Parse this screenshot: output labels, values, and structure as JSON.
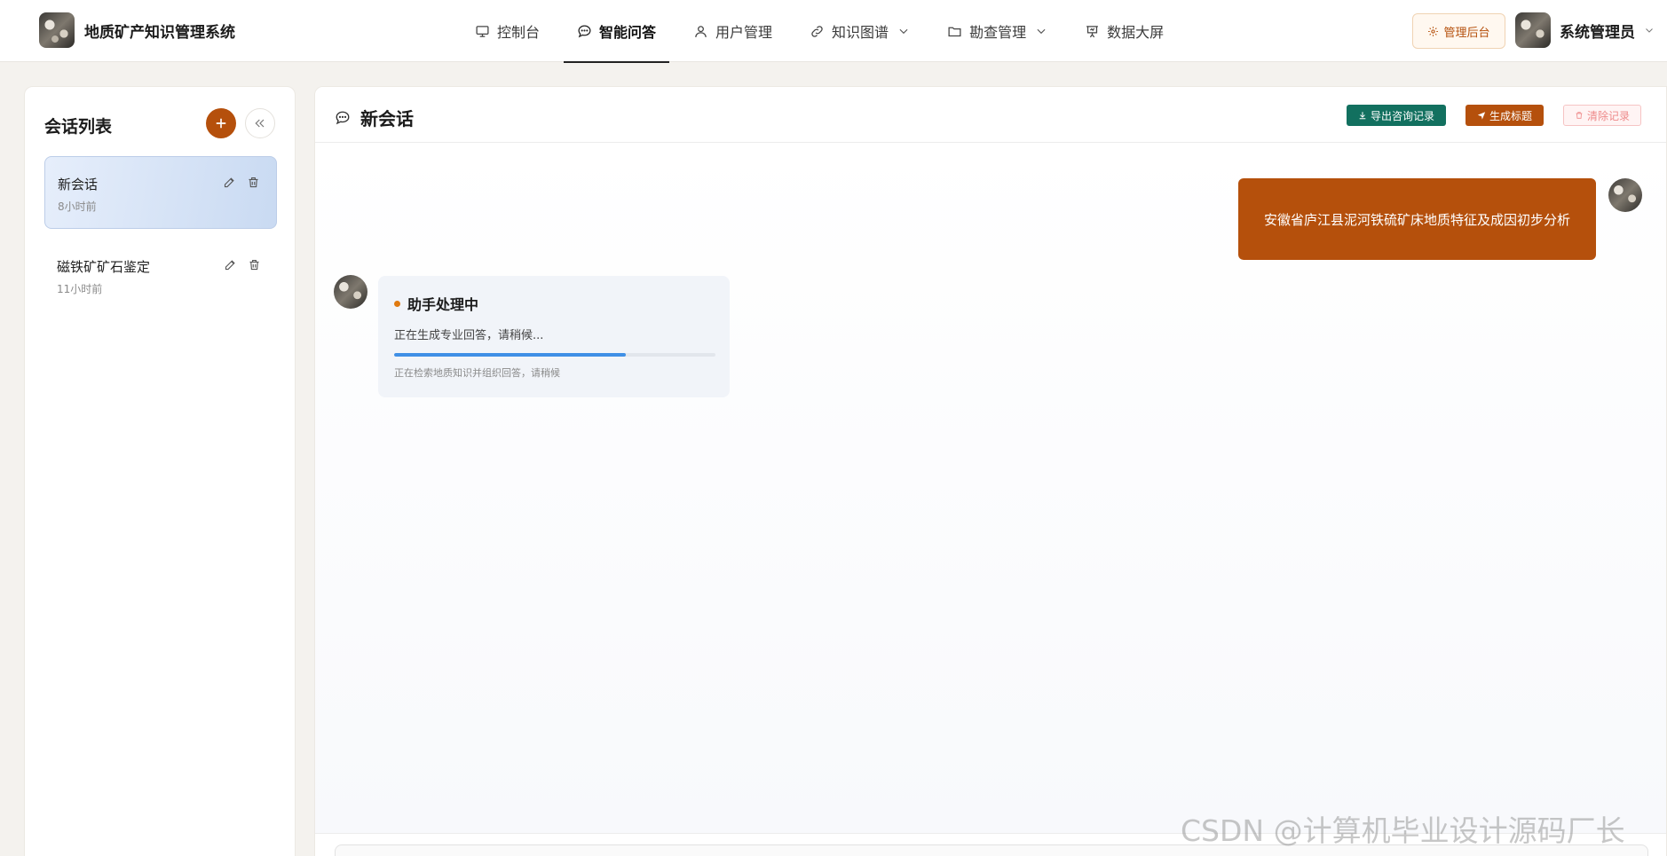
{
  "header": {
    "app_title": "地质矿产知识管理系统",
    "nav": [
      {
        "label": "控制台",
        "icon": "monitor-icon"
      },
      {
        "label": "智能问答",
        "icon": "chat-bubble-icon",
        "active": true
      },
      {
        "label": "用户管理",
        "icon": "user-icon"
      },
      {
        "label": "知识图谱",
        "icon": "link-icon",
        "dropdown": true
      },
      {
        "label": "勘查管理",
        "icon": "folder-icon",
        "dropdown": true
      },
      {
        "label": "数据大屏",
        "icon": "presentation-icon"
      }
    ],
    "admin_button": "管理后台",
    "user_name": "系统管理员"
  },
  "sidebar": {
    "title": "会话列表",
    "conversations": [
      {
        "name": "新会话",
        "time": "8小时前",
        "active": true
      },
      {
        "name": "磁铁矿矿石鉴定",
        "time": "11小时前",
        "active": false
      }
    ]
  },
  "chat": {
    "title": "新会话",
    "buttons": {
      "export": "导出咨询记录",
      "generate_title": "生成标题",
      "clear": "清除记录"
    },
    "user_message": "安徽省庐江县泥河铁硫矿床地质特征及成因初步分析",
    "assistant": {
      "status": "助手处理中",
      "line": "正在生成专业回答，请稍候...",
      "progress": 0.72,
      "subtext": "正在检索地质知识并组织回答，请稍候"
    }
  },
  "watermark": "CSDN @计算机毕业设计源码厂长",
  "colors": {
    "accent": "#b5500c",
    "export_green": "#12705f",
    "progress_blue": "#3f8fe6",
    "clear_red": "#ee8a8a"
  }
}
